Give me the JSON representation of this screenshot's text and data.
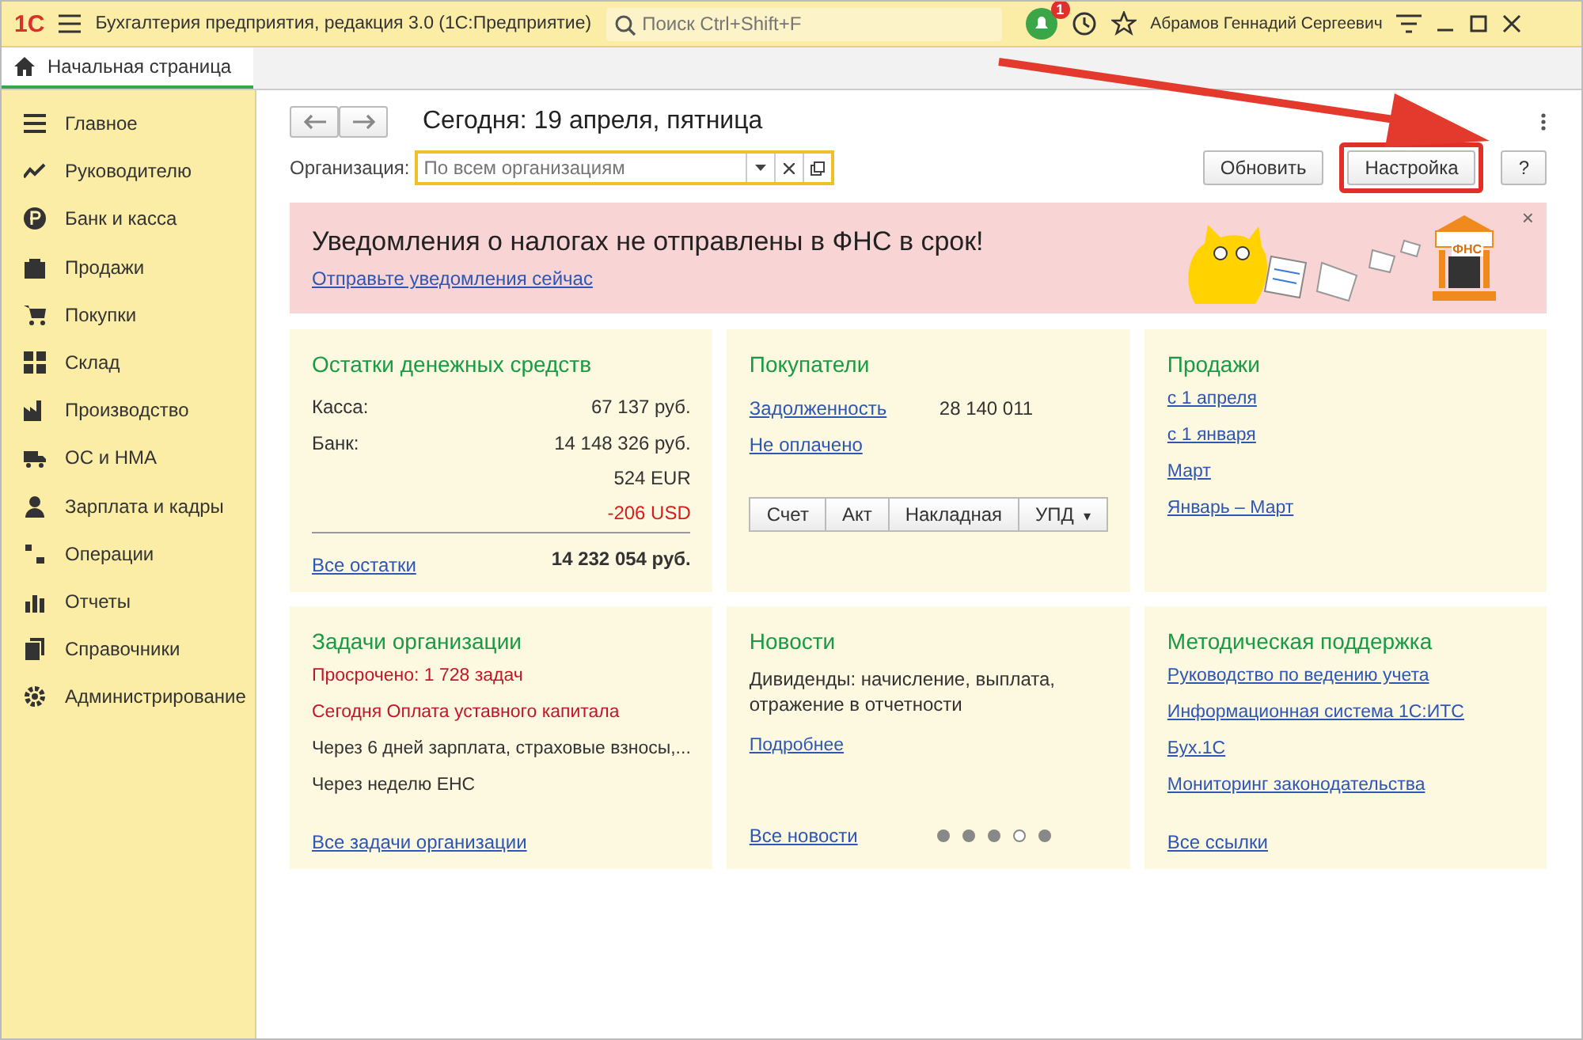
{
  "titlebar": {
    "logo": "1С",
    "title": "Бухгалтерия предприятия, редакция 3.0  (1С:Предприятие)",
    "search": {
      "placeholder": "Поиск Ctrl+Shift+F"
    },
    "notifications": "1",
    "user": "Абрамов Геннадий Сергеевич"
  },
  "tabs": [
    {
      "label": "Начальная страница",
      "selected": true
    }
  ],
  "sidebar": {
    "items": [
      {
        "label": "Главное"
      },
      {
        "label": "Руководителю"
      },
      {
        "label": "Банк и касса"
      },
      {
        "label": "Продажи"
      },
      {
        "label": "Покупки"
      },
      {
        "label": "Склад"
      },
      {
        "label": "Производство"
      },
      {
        "label": "ОС и НМА"
      },
      {
        "label": "Зарплата и кадры"
      },
      {
        "label": "Операции"
      },
      {
        "label": "Отчеты"
      },
      {
        "label": "Справочники"
      },
      {
        "label": "Администрирование"
      }
    ]
  },
  "header": {
    "title": "Сегодня: 19 апреля, пятница",
    "org_label": "Организация:",
    "org_field": {
      "placeholder": "По всем организациям"
    },
    "buttons": [
      {
        "label": "Обновить",
        "highlighted": false
      },
      {
        "label": "Настройка",
        "highlighted": true
      },
      {
        "label": "?",
        "highlighted": false
      }
    ]
  },
  "banner": {
    "title": "Уведомления о налогах не отправлены в ФНС в срок!",
    "link": "Отправьте уведомления сейчас",
    "close": "×",
    "badge": "ФНС"
  },
  "cards": [
    {
      "kind": "cash",
      "title": "Остатки денежных средств",
      "rows": [
        {
          "label": "Касса:",
          "value": "67 137 руб.",
          "negative": false
        },
        {
          "label": "Банк:",
          "value": "14 148 326 руб.",
          "negative": false
        },
        {
          "label": "",
          "value": "524 EUR",
          "negative": false
        },
        {
          "label": "",
          "value": "-206 USD",
          "negative": true
        }
      ],
      "link": "Все остатки",
      "total": "14 232 054 руб."
    },
    {
      "kind": "customers",
      "title": "Покупатели",
      "rows": [
        {
          "link": "Задолженность",
          "value": "28 140 011"
        },
        {
          "link": "Не оплачено",
          "value": ""
        }
      ],
      "buttons": [
        "Счет",
        "Акт",
        "Накладная",
        "УПД"
      ],
      "dropdown": "▾"
    },
    {
      "kind": "links",
      "title": "Продажи",
      "links": [
        "с 1 апреля",
        "с 1 января",
        "Март",
        "Январь – Март"
      ]
    },
    {
      "kind": "tasks",
      "title": "Задачи организации",
      "items": [
        {
          "text": "Просрочено: 1 728 задач",
          "alert": true
        },
        {
          "text": "Сегодня Оплата уставного капитала",
          "alert": true
        },
        {
          "text": "Через 6 дней зарплата, страховые взносы,...",
          "alert": false
        },
        {
          "text": "Через неделю ЕНС",
          "alert": false
        }
      ],
      "link": "Все задачи организации"
    },
    {
      "kind": "news",
      "title": "Новости",
      "text": "Дивиденды: начисление, выплата, отражение в отчетности",
      "more": "Подробнее",
      "link": "Все новости",
      "dots": [
        {
          "selected": false
        },
        {
          "selected": false
        },
        {
          "selected": false
        },
        {
          "selected": true
        },
        {
          "selected": false
        }
      ]
    },
    {
      "kind": "links",
      "title": "Методическая поддержка",
      "links": [
        "Руководство по ведению учета",
        "Информационная система 1С:ИТС",
        "Бух.1С",
        "Мониторинг законодательства"
      ],
      "link": "Все ссылки"
    }
  ]
}
